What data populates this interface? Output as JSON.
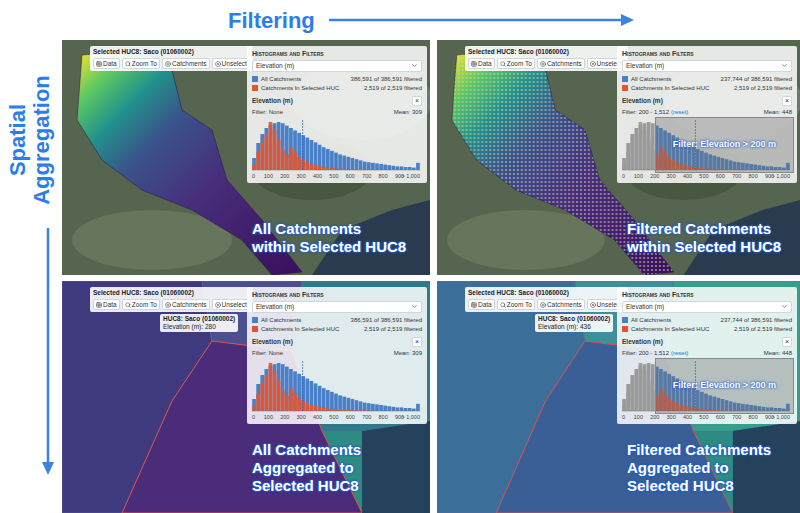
{
  "axis_labels": {
    "horizontal": "Filtering",
    "vertical": "Spatial Aggregation"
  },
  "histogram_bins": {
    "bin_width": 25,
    "ticks": [
      "0",
      "100",
      "200",
      "300",
      "400",
      "500",
      "600",
      "700",
      "800",
      "900",
      "> 1,000"
    ],
    "series": [
      {
        "name": "All Catchments",
        "color": "#4a80c8",
        "values": [
          20,
          45,
          60,
          70,
          75,
          78,
          80,
          78,
          74,
          70,
          66,
          62,
          58,
          54,
          50,
          46,
          42,
          38,
          35,
          32,
          29,
          26,
          24,
          22,
          20,
          18,
          16,
          14,
          13,
          12,
          11,
          10,
          9,
          8,
          7,
          6,
          6,
          5,
          5,
          4,
          12
        ]
      },
      {
        "name": "Catchments In Selected HUC",
        "color": "#e5532d",
        "values": [
          10,
          35,
          55,
          70,
          95,
          80,
          60,
          40,
          30,
          45,
          35,
          25,
          20,
          15,
          12,
          10,
          8,
          6,
          5,
          4,
          3,
          3,
          2,
          2,
          2,
          1,
          1,
          1,
          1,
          1,
          0,
          0,
          0,
          0,
          0,
          0,
          0,
          0,
          0,
          0,
          0
        ]
      }
    ]
  },
  "panels": [
    {
      "kind": "catchments",
      "filtered": false,
      "selected_box": {
        "title": "Selected HUC8: Saco (01060002)",
        "buttons": [
          "Data",
          "Zoom To",
          "Catchments",
          "Unselect"
        ]
      },
      "tooltip": null,
      "histogram": {
        "title": "Histograms and Filters",
        "select": "Elevation (m)",
        "legend": [
          {
            "label": "All Catchments",
            "count": "386,591 of 386,591 filtered",
            "color": "#4a80c8"
          },
          {
            "label": "Catchments In Selected HUC",
            "count": "2,519 of 2,519 filtered",
            "color": "#e5532d"
          }
        ],
        "chart_title": "Elevation (m)",
        "close": "×",
        "filter_text": "Filter: None",
        "reset": null,
        "mean_text": "Mean: 309",
        "mean_value": 309,
        "filter_min": null,
        "filter_note": null
      },
      "caption": [
        "All Catchments",
        "within Selected HUC8"
      ]
    },
    {
      "kind": "catchments",
      "filtered": true,
      "selected_box": {
        "title": "Selected HUC8: Saco (01060002)",
        "buttons": [
          "Data",
          "Zoom To",
          "Catchments",
          "Unselect"
        ]
      },
      "tooltip": null,
      "histogram": {
        "title": "Histograms and Filters",
        "select": "Elevation (m)",
        "legend": [
          {
            "label": "All Catchments",
            "count": "237,744 of 386,591 filtered",
            "color": "#4a80c8"
          },
          {
            "label": "Catchments In Selected HUC",
            "count": "2,519 of 2,519 filtered",
            "color": "#e5532d"
          }
        ],
        "chart_title": "Elevation (m)",
        "close": "×",
        "filter_text": "Filter: 200 - 1,512",
        "reset": "(reset)",
        "mean_text": "Mean: 448",
        "mean_value": 448,
        "filter_min": 200,
        "filter_note": "Filter: Elevation > 200 m"
      },
      "caption": [
        "Filtered Catchments",
        "within Selected HUC8"
      ]
    },
    {
      "kind": "huc",
      "filtered": false,
      "selected_box": {
        "title": "Selected HUC8: Saco (01060002)",
        "buttons": [
          "Data",
          "Zoom To",
          "Catchments",
          "Unselect"
        ]
      },
      "tooltip": {
        "title": "HUC8: Saco (01060002)",
        "value": "Elevation (m): 280"
      },
      "histogram": {
        "title": "Histograms and Filters",
        "select": "Elevation (m)",
        "legend": [
          {
            "label": "All Catchments",
            "count": "386,591 of 386,591 filtered",
            "color": "#4a80c8"
          },
          {
            "label": "Catchments In Selected HUC",
            "count": "2,519 of 2,519 filtered",
            "color": "#e5532d"
          }
        ],
        "chart_title": "Elevation (m)",
        "close": "×",
        "filter_text": "Filter: None",
        "reset": null,
        "mean_text": "Mean: 309",
        "mean_value": 309,
        "filter_min": null,
        "filter_note": null
      },
      "caption": [
        "All Catchments",
        "Aggregated to",
        "Selected HUC8"
      ]
    },
    {
      "kind": "huc",
      "filtered": true,
      "selected_box": {
        "title": "Selected HUC8: Saco (01060002)",
        "buttons": [
          "Data",
          "Zoom To",
          "Catchments",
          "Unselect"
        ]
      },
      "tooltip": {
        "title": "HUC8: Saco (01060002)",
        "value": "Elevation (m): 436"
      },
      "histogram": {
        "title": "Histograms and Filters",
        "select": "Elevation (m)",
        "legend": [
          {
            "label": "All Catchments",
            "count": "237,744 of 386,591 filtered",
            "color": "#4a80c8"
          },
          {
            "label": "Catchments In Selected HUC",
            "count": "2,519 of 2,519 filtered",
            "color": "#e5532d"
          }
        ],
        "chart_title": "Elevation (m)",
        "close": "×",
        "filter_text": "Filter: 200 - 1,512",
        "reset": "(reset)",
        "mean_text": "Mean: 448",
        "mean_value": 448,
        "filter_min": 200,
        "filter_note": "Filter: Elevation > 200 m"
      },
      "caption": [
        "Filtered Catchments",
        "Aggregated to",
        "Selected HUC8"
      ]
    }
  ]
}
